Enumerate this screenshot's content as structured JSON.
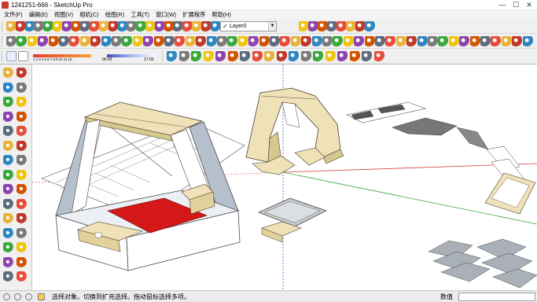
{
  "window": {
    "title": "1241251-666 - SketchUp Pro",
    "min_glyph": "—",
    "max_glyph": "☐",
    "close_glyph": "✕"
  },
  "menu": [
    "文件(F)",
    "编辑(E)",
    "视图(V)",
    "相机(C)",
    "绘图(R)",
    "工具(T)",
    "窗口(W)",
    "扩展程序",
    "帮助(H)"
  ],
  "layer": {
    "current": "Layer0",
    "check_glyph": "✓",
    "dropdown_glyph": "▼"
  },
  "shadow": {
    "month_labels": "1 2 3 4 5 6 7 8 9 10 11 12",
    "time_start": "06:43",
    "time_end": "17:00"
  },
  "status": {
    "hint": "选择对象。切换到扩充选择。拖动鼠标选择多项。",
    "measurements_label": "数值",
    "measurements_value": ""
  },
  "colors": {
    "plywood": "#efe2b8",
    "plywood_edge": "#4a4030",
    "gray_panel": "#b6c0cc",
    "red_plate": "#d41818",
    "axis_red": "#d44040",
    "axis_green": "#3aa83a",
    "axis_blue": "#4050d0"
  },
  "icons": {
    "toolbar1": [
      "select-icon",
      "line-icon",
      "arc-icon",
      "rectangle-icon",
      "circle-icon",
      "polygon-icon",
      "eraser-icon",
      "tape-icon",
      "dimension-icon",
      "protractor-icon",
      "text-icon",
      "axes-icon",
      "3d-text-icon",
      "paint-icon",
      "move-icon",
      "rotate-icon",
      "scale-icon",
      "offset-icon",
      "push-pull-icon",
      "follow-me-icon",
      "intersect-icon",
      "outer-shell-icon",
      "union-icon"
    ],
    "toolbar3": [
      "standard-views-icon",
      "iso-icon",
      "top-icon",
      "front-icon",
      "right-icon",
      "back-icon",
      "left-icon",
      "xray-icon",
      "back-edges-icon",
      "wireframe-icon",
      "hidden-line-icon",
      "shaded-icon",
      "textured-icon",
      "monochrome-icon",
      "component-icon",
      "warehouse-icon",
      "extension-icon",
      "layout-icon"
    ],
    "left": [
      "select-icon",
      "make-component-icon",
      "paint-bucket-icon",
      "eraser-icon",
      "line-icon",
      "freehand-icon",
      "rectangle-icon",
      "rotated-rect-icon",
      "circle-icon",
      "polygon-icon",
      "arc-icon",
      "pie-icon",
      "move-icon",
      "push-pull-icon",
      "rotate-icon",
      "follow-me-icon",
      "scale-icon",
      "offset-icon",
      "tape-icon",
      "text-icon",
      "protractor-icon",
      "axes-icon",
      "orbit-icon",
      "pan-icon",
      "zoom-icon",
      "zoom-extents-icon",
      "walk-icon",
      "look-around-icon",
      "section-plane-icon",
      "position-camera-icon"
    ]
  }
}
